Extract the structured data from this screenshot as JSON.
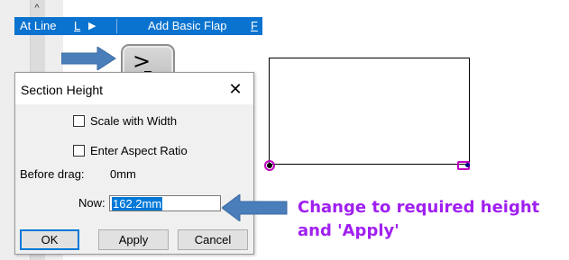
{
  "menu": {
    "at_line_label": "At Line",
    "at_line_shortcut": "L",
    "submenu_arrow": "▶",
    "add_basic_flap_label": "Add Basic Flap",
    "add_basic_flap_shortcut": "F"
  },
  "key_icon": {
    "caret": ">"
  },
  "dialog": {
    "title": "Section Height",
    "close_glyph": "✕",
    "scale_with_width_label": "Scale with Width",
    "scale_with_width_checked": false,
    "enter_aspect_ratio_label": "Enter Aspect Ratio",
    "enter_aspect_ratio_checked": false,
    "before_drag_label": "Before drag:",
    "before_drag_value": "0mm",
    "now_label": "Now:",
    "now_value": "162.2mm",
    "ok_label": "OK",
    "apply_label": "Apply",
    "cancel_label": "Cancel"
  },
  "annotation": {
    "line1": "Change to required height",
    "line2": "and 'Apply'",
    "color": "#a020f0"
  },
  "colors": {
    "menu_bar": "#0a73cf",
    "arrow": "#4a7ebb",
    "handle": "#c000c0"
  },
  "scroll_up_glyph": "^"
}
